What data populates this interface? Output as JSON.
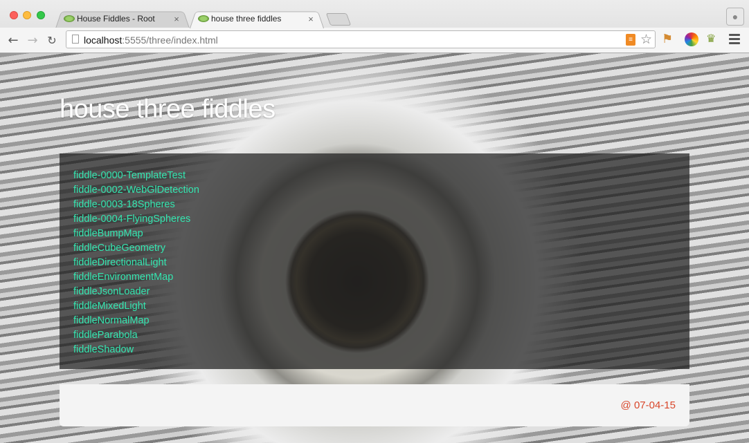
{
  "browser": {
    "tabs": [
      {
        "title": "House Fiddles - Root",
        "active": false
      },
      {
        "title": "house three fiddles",
        "active": true
      }
    ],
    "close_glyph": "×",
    "address": {
      "host": "localhost",
      "path": ":5555/three/index.html"
    },
    "icons": [
      "back-arrow-icon",
      "forward-arrow-icon",
      "reload-icon",
      "page-icon",
      "rss-feed-icon",
      "bookmark-star-icon",
      "extension-icon",
      "color-wheel-icon",
      "extension-icon",
      "menu-icon",
      "profile-icon"
    ]
  },
  "page": {
    "title": "house three fiddles",
    "fiddles": [
      "fiddle-0000-TemplateTest",
      "fiddle-0002-WebGlDetection",
      "fiddle-0003-18Spheres",
      "fiddle-0004-FlyingSpheres",
      "fiddleBumpMap",
      "fiddleCubeGeometry",
      "fiddleDirectionalLight",
      "fiddleEnvironmentMap",
      "fiddleJsonLoader",
      "fiddleMixedLight",
      "fiddleNormalMap",
      "fiddleParabola",
      "fiddleShadow"
    ],
    "footer_date": "@ 07-04-15"
  },
  "colors": {
    "link": "#34e6b0",
    "footer_date": "#d9472b",
    "panel": "rgba(30,30,30,0.72)"
  }
}
